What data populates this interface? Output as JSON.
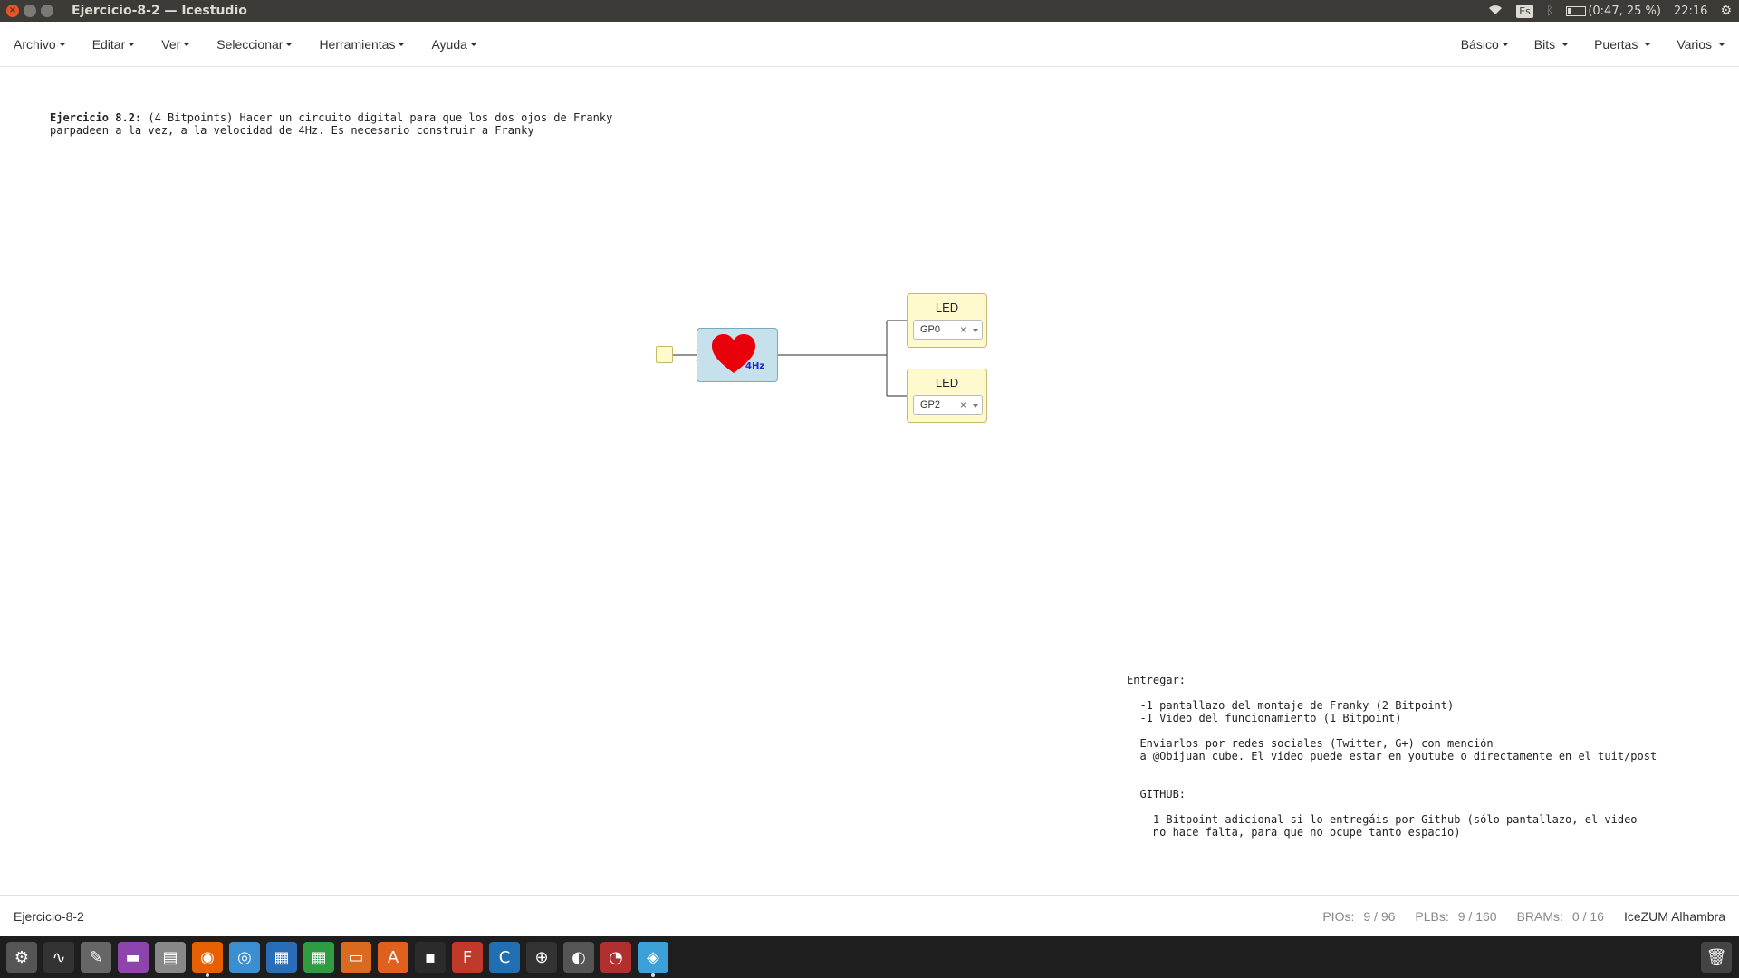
{
  "window": {
    "title": "Ejercicio-8-2 — Icestudio",
    "close_glyph": "×",
    "min_glyph": "",
    "max_glyph": ""
  },
  "tray": {
    "keyboard": "Es",
    "battery": "(0:47, 25 %)",
    "time": "22:16"
  },
  "menubar": {
    "left": [
      "Archivo",
      "Editar",
      "Ver",
      "Seleccionar",
      "Herramientas",
      "Ayuda"
    ],
    "right": [
      "Básico",
      "Bits",
      "Puertas",
      "Varios"
    ]
  },
  "canvas": {
    "exercise_title": "Ejercicio 8.2:",
    "exercise_line1": " (4 Bitpoints) Hacer un circuito digital para que los dos ojos de Franky",
    "exercise_line2": "parpadeen a la vez, a la velocidad de 4Hz. Es necesario construir a Franky",
    "deliver_text": "Entregar:\n\n  -1 pantallazo del montaje de Franky (2 Bitpoint)\n  -1 Video del funcionamiento (1 Bitpoint)\n\n  Enviarlos por redes sociales (Twitter, G+) con mención\n  a @Obijuan_cube. El video puede estar en youtube o directamente en el tuit/post\n\n\n  GITHUB:\n\n    1 Bitpoint adicional si lo entregáis por Github (sólo pantallazo, el video\n    no hace falta, para que no ocupe tanto espacio)",
    "heart_block": {
      "label": "4Hz",
      "color": "#e8000b"
    },
    "leds": [
      {
        "title": "LED",
        "pin": "GP0",
        "clear": "×"
      },
      {
        "title": "LED",
        "pin": "GP2",
        "clear": "×"
      }
    ]
  },
  "statusbar": {
    "project": "Ejercicio-8-2",
    "pios_label": "PIOs:",
    "pios_value": "9 / 96",
    "plbs_label": "PLBs:",
    "plbs_value": "9 / 160",
    "brams_label": "BRAMs:",
    "brams_value": "0 / 16",
    "board": "IceZUM Alhambra"
  },
  "taskbar": {
    "apps": [
      {
        "name": "system-settings-icon",
        "glyph": "⚙",
        "bg": "#555"
      },
      {
        "name": "system-monitor-icon",
        "glyph": "∿",
        "bg": "#333"
      },
      {
        "name": "tools-icon",
        "glyph": "✎",
        "bg": "#666"
      },
      {
        "name": "terminal-icon",
        "glyph": "▬",
        "bg": "#8e44ad"
      },
      {
        "name": "files-icon",
        "glyph": "▤",
        "bg": "#888"
      },
      {
        "name": "firefox-icon",
        "glyph": "◉",
        "bg": "#e66000"
      },
      {
        "name": "chrome-icon",
        "glyph": "◎",
        "bg": "#3b8ed0"
      },
      {
        "name": "writer-icon",
        "glyph": "▦",
        "bg": "#2a6cb5"
      },
      {
        "name": "calc-icon",
        "glyph": "▦",
        "bg": "#2f9c42"
      },
      {
        "name": "impress-icon",
        "glyph": "▭",
        "bg": "#d86b1f"
      },
      {
        "name": "software-center-icon",
        "glyph": "A",
        "bg": "#e06020"
      },
      {
        "name": "terminal-dark-icon",
        "glyph": "▪",
        "bg": "#2b2b2b"
      },
      {
        "name": "freecad-icon",
        "glyph": "F",
        "bg": "#c0392b"
      },
      {
        "name": "cura-icon",
        "glyph": "C",
        "bg": "#1f6fb2"
      },
      {
        "name": "crosshair-icon",
        "glyph": "⊕",
        "bg": "#333"
      },
      {
        "name": "steam-icon",
        "glyph": "◐",
        "bg": "#555"
      },
      {
        "name": "screenshot-icon",
        "glyph": "◔",
        "bg": "#b03030"
      },
      {
        "name": "icestudio-icon",
        "glyph": "◈",
        "bg": "#3ba1d8"
      }
    ],
    "trash_glyph": "🗑"
  }
}
